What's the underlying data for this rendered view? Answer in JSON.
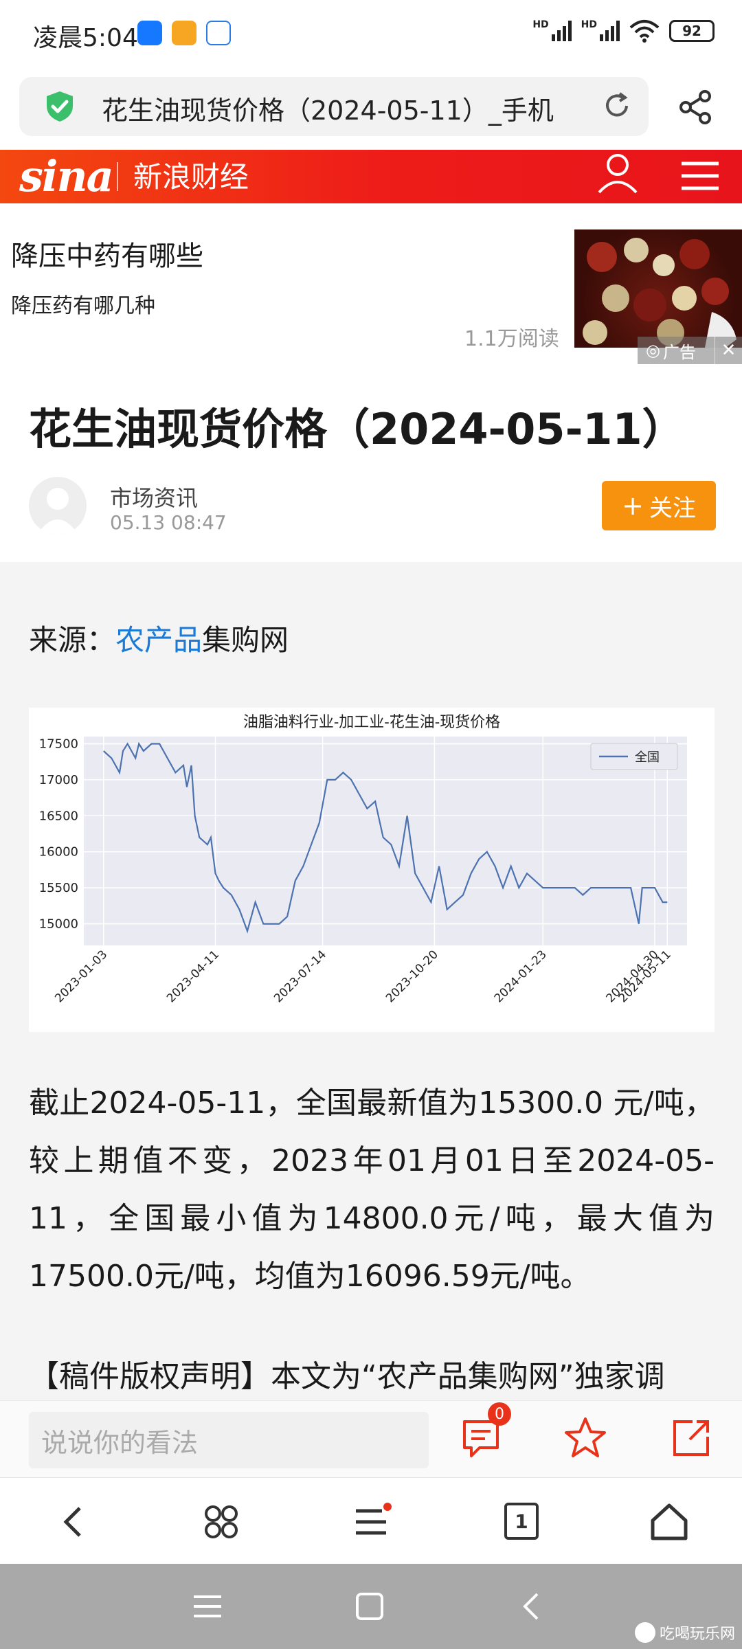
{
  "status_bar": {
    "time": "凌晨5:04",
    "net_label_1": "HD",
    "net_label_2": "HD",
    "battery": "92"
  },
  "url_bar": {
    "title": "花生油现货价格（2024-05-11）_手机"
  },
  "site_header": {
    "logo": "sina",
    "channel": "新浪财经"
  },
  "ad": {
    "title": "降压中药有哪些",
    "subtitle": "降压药有哪几种",
    "reads": "1.1万阅读",
    "tag": "广告",
    "close": "✕"
  },
  "article": {
    "title": "花生油现货价格（2024-05-11）",
    "author": "市场资讯",
    "time": "05.13  08:47",
    "follow_label": "关注",
    "source_prefix": "来源：",
    "source_link": "农产品",
    "source_suffix": "集购网",
    "paragraph": "截止2024-05-11，全国最新值为15300.0 元/吨，较上期值不变，2023年01月01日至2024-05-11，全国最小值为14800.0元/吨，最大值为17500.0元/吨，均值为16096.59元/吨。",
    "paragraph2": "【稿件版权声明】本文为“农产品集购网”独家调"
  },
  "chart_data": {
    "type": "line",
    "title": "油脂油料行业-加工业-花生油-现货价格",
    "xlabel": "",
    "ylabel": "",
    "x_ticks": [
      "2023-01-03",
      "2023-04-11",
      "2023-07-14",
      "2023-10-20",
      "2024-01-23",
      "2024-04-30",
      "2024-05-11"
    ],
    "y_ticks": [
      15000,
      15500,
      16000,
      16500,
      17000,
      17500
    ],
    "ylim": [
      14700,
      17600
    ],
    "grid": true,
    "legend_position": "top-right",
    "series": [
      {
        "name": "全国",
        "color": "#4c72b0",
        "x": [
          "2023-01-03",
          "2023-01-10",
          "2023-01-17",
          "2023-01-20",
          "2023-01-24",
          "2023-01-31",
          "2023-02-03",
          "2023-02-07",
          "2023-02-14",
          "2023-02-21",
          "2023-02-28",
          "2023-03-07",
          "2023-03-14",
          "2023-03-17",
          "2023-03-21",
          "2023-03-24",
          "2023-03-28",
          "2023-04-04",
          "2023-04-07",
          "2023-04-11",
          "2023-04-14",
          "2023-04-18",
          "2023-04-25",
          "2023-05-02",
          "2023-05-09",
          "2023-05-16",
          "2023-05-23",
          "2023-05-30",
          "2023-06-06",
          "2023-06-13",
          "2023-06-20",
          "2023-06-27",
          "2023-07-04",
          "2023-07-11",
          "2023-07-18",
          "2023-07-25",
          "2023-08-01",
          "2023-08-08",
          "2023-08-15",
          "2023-08-22",
          "2023-08-29",
          "2023-09-05",
          "2023-09-12",
          "2023-09-19",
          "2023-09-26",
          "2023-10-03",
          "2023-10-10",
          "2023-10-17",
          "2023-10-24",
          "2023-10-31",
          "2023-11-07",
          "2023-11-14",
          "2023-11-21",
          "2023-11-28",
          "2023-12-05",
          "2023-12-12",
          "2023-12-19",
          "2023-12-26",
          "2024-01-02",
          "2024-01-09",
          "2024-01-16",
          "2024-01-23",
          "2024-01-30",
          "2024-02-06",
          "2024-02-20",
          "2024-02-27",
          "2024-03-05",
          "2024-03-12",
          "2024-03-19",
          "2024-03-26",
          "2024-04-02",
          "2024-04-09",
          "2024-04-16",
          "2024-04-19",
          "2024-04-23",
          "2024-04-30",
          "2024-05-07",
          "2024-05-11"
        ],
        "values": [
          17400,
          17300,
          17100,
          17400,
          17500,
          17300,
          17500,
          17400,
          17500,
          17500,
          17300,
          17100,
          17200,
          16900,
          17200,
          16500,
          16200,
          16100,
          16200,
          15700,
          15600,
          15500,
          15400,
          15200,
          14900,
          15300,
          15000,
          15000,
          15000,
          15100,
          15600,
          15800,
          16100,
          16400,
          17000,
          17000,
          17100,
          17000,
          16800,
          16600,
          16700,
          16200,
          16100,
          15800,
          16500,
          15700,
          15500,
          15300,
          15800,
          15200,
          15300,
          15400,
          15700,
          15900,
          16000,
          15800,
          15500,
          15800,
          15500,
          15700,
          15600,
          15500,
          15500,
          15500,
          15500,
          15400,
          15500,
          15500,
          15500,
          15500,
          15500,
          15500,
          15000,
          15500,
          15500,
          15500,
          15300,
          15300
        ]
      }
    ]
  },
  "comment_bar": {
    "placeholder": "说说你的看法",
    "comment_count": "0"
  },
  "browser_nav": {
    "tab_count": "1"
  },
  "watermark": {
    "text": "吃喝玩乐网"
  }
}
